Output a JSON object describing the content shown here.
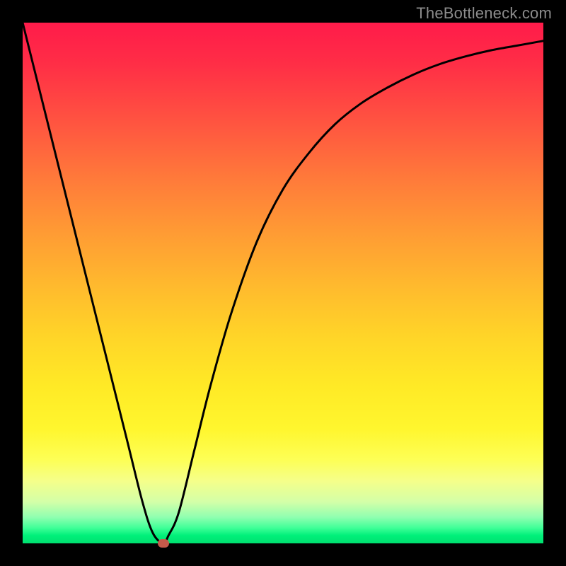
{
  "watermark": "TheBottleneck.com",
  "chart_data": {
    "type": "line",
    "title": "",
    "xlabel": "",
    "ylabel": "",
    "xlim": [
      0,
      100
    ],
    "ylim": [
      0,
      100
    ],
    "series": [
      {
        "name": "curve",
        "x": [
          0,
          5,
          10,
          15,
          20,
          23,
          25,
          27,
          28,
          30,
          33,
          36,
          40,
          45,
          50,
          55,
          60,
          65,
          70,
          75,
          80,
          85,
          90,
          95,
          100
        ],
        "values": [
          100,
          80,
          60,
          40,
          20,
          8,
          2,
          0,
          1.5,
          6,
          18,
          30,
          44,
          58,
          68,
          75,
          80.5,
          84.5,
          87.5,
          90,
          92,
          93.5,
          94.7,
          95.6,
          96.5
        ]
      }
    ],
    "marker": {
      "x": 27,
      "y": 0,
      "color": "#c45a4a"
    },
    "background_gradient": {
      "top": "#ff1b4a",
      "bottom": "#00e070"
    }
  }
}
